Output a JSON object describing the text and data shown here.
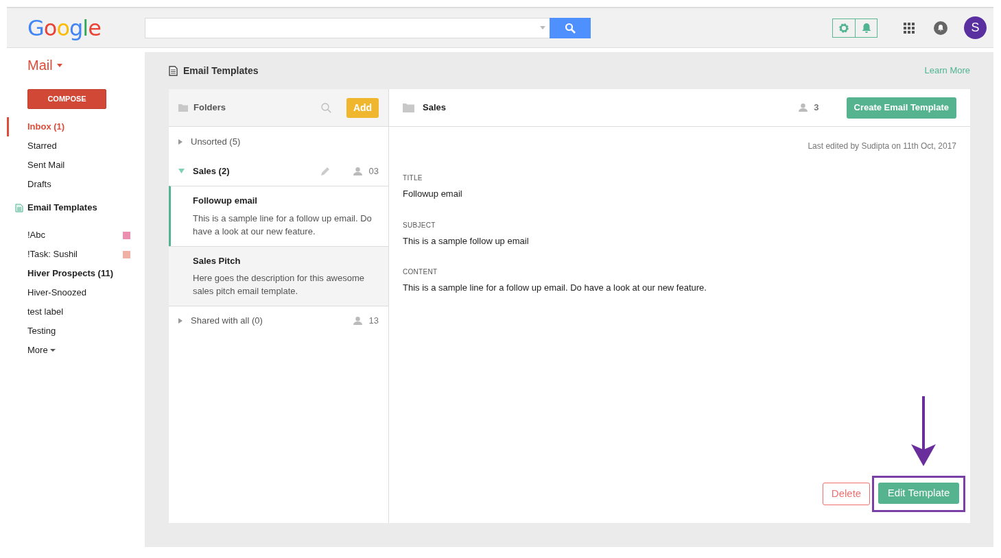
{
  "header": {
    "logo": "Google",
    "avatar": "S"
  },
  "sidebar": {
    "app": "Mail",
    "compose": "COMPOSE",
    "nav": [
      {
        "label": "Inbox (1)",
        "selected": true
      },
      {
        "label": "Starred",
        "selected": false
      },
      {
        "label": "Sent Mail",
        "selected": false
      },
      {
        "label": "Drafts",
        "selected": false
      }
    ],
    "templates_link": "Email Templates",
    "labels": [
      {
        "label": "!Abc",
        "bold": false,
        "color": "#ea8fb0"
      },
      {
        "label": "!Task: Sushil",
        "bold": false,
        "color": "#f0b0a5"
      },
      {
        "label": "Hiver Prospects (11)",
        "bold": true
      },
      {
        "label": "Hiver-Snoozed",
        "bold": false
      },
      {
        "label": "test label",
        "bold": false
      },
      {
        "label": "Testing",
        "bold": false
      }
    ],
    "more": "More"
  },
  "main": {
    "title": "Email Templates",
    "learn_more": "Learn More",
    "folders_panel": {
      "title": "Folders",
      "add": "Add",
      "folders": [
        {
          "name": "Unsorted (5)",
          "expanded": false
        },
        {
          "name": "Sales (2)",
          "expanded": true,
          "editable": true,
          "members": "03",
          "templates": [
            {
              "title": "Followup email",
              "description": "This is a sample line for a follow up email. Do have a look at our new feature.",
              "selected": true
            },
            {
              "title": "Sales Pitch",
              "description": "Here goes the description for this awesome sales pitch email template.",
              "selected": false
            }
          ]
        },
        {
          "name": "Shared with all (0)",
          "expanded": false,
          "members": "13"
        }
      ]
    },
    "detail": {
      "folder": "Sales",
      "members": "3",
      "create": "Create Email Template",
      "last_edited": "Last edited by Sudipta on 11th Oct, 2017",
      "fields": [
        {
          "label": "TITLE",
          "value": "Followup email"
        },
        {
          "label": "SUBJECT",
          "value": "This is a sample follow up email"
        },
        {
          "label": "CONTENT",
          "value": "This is a sample line for a follow up email. Do have a look at our new feature."
        }
      ],
      "delete": "Delete",
      "edit": "Edit Template",
      "edit_highlighted": true
    }
  }
}
